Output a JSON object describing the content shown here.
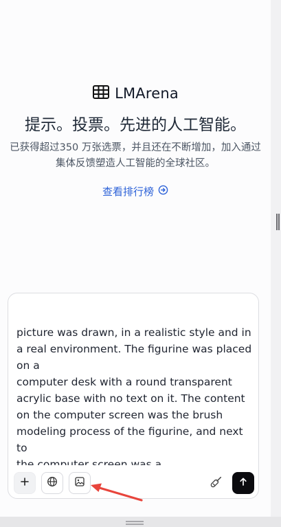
{
  "brand": {
    "name": "LMArena",
    "logo_icon": "table-grid-icon"
  },
  "hero": {
    "title": "提示。投票。先进的人工智能。",
    "subtitle": "已获得超过350 万张选票，并且还在不断增加，加入通过集体反馈塑造人工智能的全球社区。",
    "leaderboard_link": "查看排行榜",
    "leaderboard_icon": "arrow-right-circle-icon"
  },
  "composer": {
    "text": "picture was drawn, in a realistic style and in\na real environment. The figurine was placed\non a\ncomputer desk with a round transparent\nacrylic base with no text on it. The content\non the computer screen was the brush\nmodeling process of the figurine, and next to\nthe computer screen was a\nBANDAI-style toy box with the original\npainting printed on it.",
    "buttons": {
      "add_icon": "plus-icon",
      "web_icon": "globe-icon",
      "image_icon": "image-icon",
      "sweep_icon": "broom-icon",
      "send_icon": "arrow-up-icon"
    }
  },
  "annotation": {
    "arrow_color": "#e8453c"
  },
  "colors": {
    "accent_link": "#2d62d8",
    "send_bg": "#0b0b0f"
  }
}
